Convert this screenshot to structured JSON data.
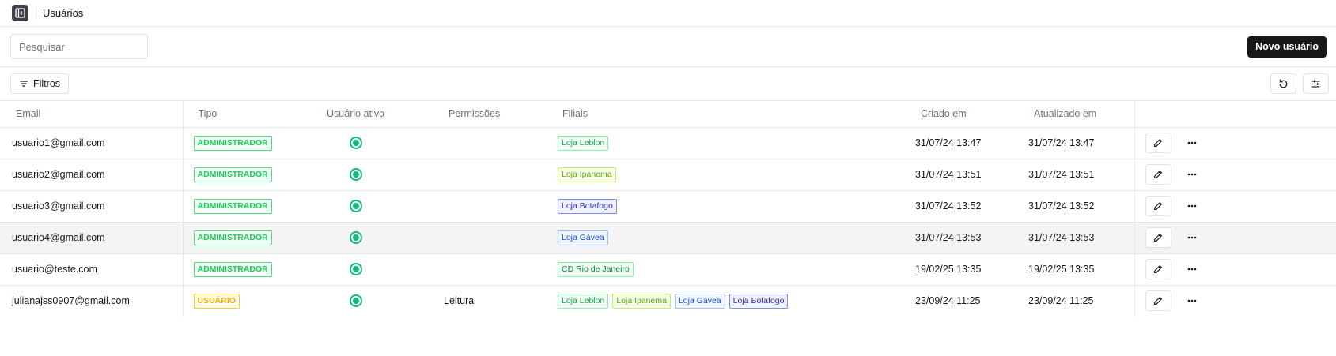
{
  "header": {
    "title": "Usuários",
    "toggle_icon": "sidebar-toggle-icon"
  },
  "toolbar": {
    "search_placeholder": "Pesquisar",
    "new_user_label": "Novo usuário",
    "filters_label": "Filtros"
  },
  "table": {
    "columns": {
      "email": "Email",
      "tipo": "Tipo",
      "ativo": "Usuário ativo",
      "permissoes": "Permissões",
      "filiais": "Filiais",
      "criado": "Criado em",
      "atualizado": "Atualizado em"
    },
    "rows": [
      {
        "email": "usuario1@gmail.com",
        "tipo": "ADMINISTRADOR",
        "ativo": true,
        "permissoes": "",
        "filiais": [
          "Loja Leblon"
        ],
        "criado": "31/07/24 13:47",
        "atualizado": "31/07/24 13:47"
      },
      {
        "email": "usuario2@gmail.com",
        "tipo": "ADMINISTRADOR",
        "ativo": true,
        "permissoes": "",
        "filiais": [
          "Loja Ipanema"
        ],
        "criado": "31/07/24 13:51",
        "atualizado": "31/07/24 13:51"
      },
      {
        "email": "usuario3@gmail.com",
        "tipo": "ADMINISTRADOR",
        "ativo": true,
        "permissoes": "",
        "filiais": [
          "Loja Botafogo"
        ],
        "criado": "31/07/24 13:52",
        "atualizado": "31/07/24 13:52"
      },
      {
        "email": "usuario4@gmail.com",
        "tipo": "ADMINISTRADOR",
        "ativo": true,
        "permissoes": "",
        "filiais": [
          "Loja Gávea"
        ],
        "criado": "31/07/24 13:53",
        "atualizado": "31/07/24 13:53"
      },
      {
        "email": "usuario@teste.com",
        "tipo": "ADMINISTRADOR",
        "ativo": true,
        "permissoes": "",
        "filiais": [
          "CD Rio de Janeiro"
        ],
        "criado": "19/02/25 13:35",
        "atualizado": "19/02/25 13:35"
      },
      {
        "email": "julianajss0907@gmail.com",
        "tipo": "USUÁRIO",
        "ativo": true,
        "permissoes": "Leitura",
        "filiais": [
          "Loja Leblon",
          "Loja Ipanema",
          "Loja Gávea",
          "Loja Botafogo"
        ],
        "criado": "23/09/24 11:25",
        "atualizado": "23/09/24 11:25"
      }
    ],
    "highlighted_row": 3
  },
  "colors": {
    "primary": "#18181b",
    "active": "#10b981",
    "tipo": {
      "ADMINISTRADOR": {
        "fg": "#22c55e",
        "border": "#4ade80",
        "bg": "#f0fdf4"
      },
      "USUÁRIO": {
        "fg": "#eab308",
        "border": "#facc15",
        "bg": "#fefce8"
      }
    },
    "filiais": {
      "Loja Leblon": {
        "fg": "#16a34a",
        "border": "#86efac",
        "bg": "#f0fdf4"
      },
      "Loja Ipanema": {
        "fg": "#65a30d",
        "border": "#bef264",
        "bg": "#f7fee7"
      },
      "Loja Botafogo": {
        "fg": "#3730a3",
        "border": "#818cf8",
        "bg": "#eef2ff"
      },
      "Loja Gávea": {
        "fg": "#1d4ed8",
        "border": "#93c5fd",
        "bg": "#eff6ff"
      },
      "CD Rio de Janeiro": {
        "fg": "#15803d",
        "border": "#86efac",
        "bg": "#f0fdf4"
      }
    }
  },
  "icons": {
    "filter": "filter-icon",
    "refresh": "refresh-icon",
    "columns": "columns-settings-icon",
    "edit": "pencil-icon",
    "more": "more-horizontal-icon"
  }
}
